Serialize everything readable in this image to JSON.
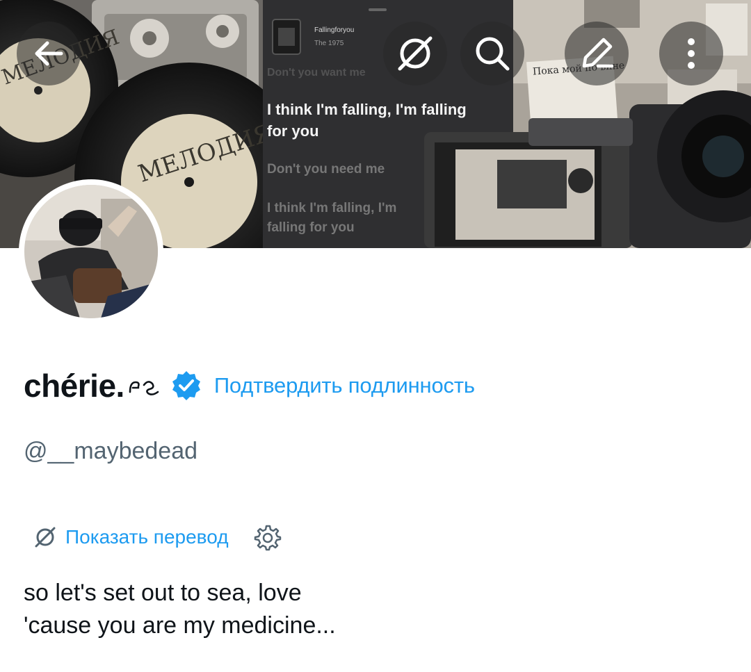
{
  "banner": {
    "track": {
      "title": "Fallingforyou",
      "artist": "The 1975"
    },
    "lyrics": {
      "top_faded": "Don't you want me",
      "current": "I think I'm falling, I'm falling for you",
      "next_1": "Don't you need me",
      "next_2": "I think I'm falling, I'm falling for you"
    },
    "record_label": "МЕЛОДИЯ",
    "record_label_2": "МЕЛОДИЯ",
    "photo_scribble": "Пока мой по вине"
  },
  "topbar": {
    "back_icon": "arrow-left-icon",
    "translate_off_icon": "translate-off-icon",
    "search_icon": "search-icon",
    "edit_icon": "pencil-icon",
    "more_icon": "more-vertical-icon"
  },
  "profile": {
    "display_name": "chérie.",
    "name_glyph_icon": "decorative-glyph",
    "verified_icon": "verified-badge-icon",
    "verify_link": "Подтвердить подлинность",
    "handle": "@__maybedead",
    "translate_link": "Показать перевод",
    "bio_lines": [
      "so let's set out to sea, love",
      "'cause you are my medicine..."
    ]
  },
  "colors": {
    "accent": "#1d9bf0",
    "text": "#0f1419",
    "secondary_text": "#536471",
    "verified_badge": "#1d9bf0"
  }
}
